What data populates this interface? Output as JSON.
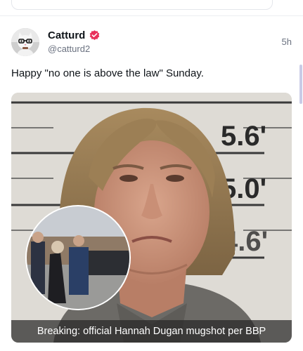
{
  "post": {
    "author": {
      "display_name": "Catturd",
      "handle": "@catturd2",
      "avatar_icon": "cat-avatar-icon",
      "verified_icon": "verified-badge-icon",
      "verified_color": "#e8305a"
    },
    "timestamp": "5h",
    "text": "Happy \"no one is above the law\" Sunday.",
    "media": {
      "type": "image",
      "description_icon": "mugshot-photo",
      "height_marks": [
        "5.6'",
        "5.0'",
        "4.6'"
      ],
      "inset_icon": "courthouse-photo-inset",
      "caption": "Breaking: official Hannah Dugan mugshot per BBP"
    }
  },
  "colors": {
    "text": "#0f1419",
    "muted": "#6b7280",
    "divider": "#eceef1"
  }
}
